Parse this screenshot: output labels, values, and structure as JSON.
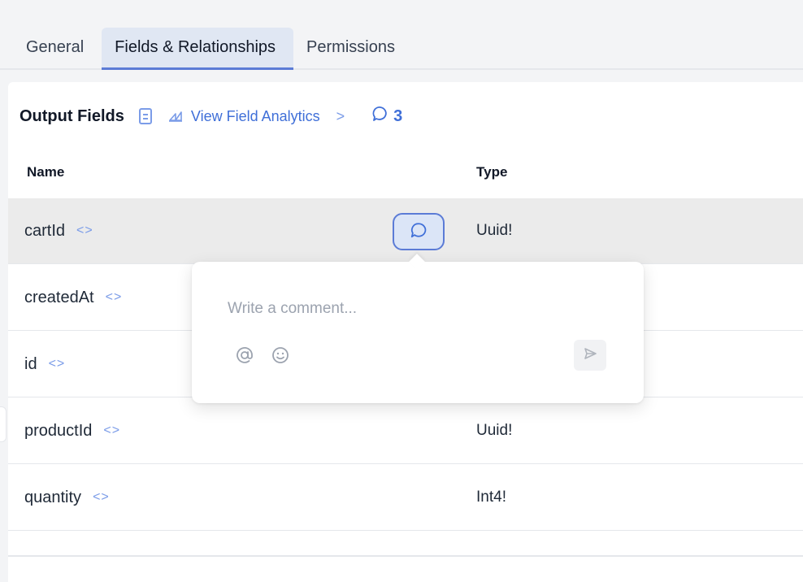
{
  "tabs": [
    {
      "label": "General",
      "active": false
    },
    {
      "label": "Fields & Relationships",
      "active": true
    },
    {
      "label": "Permissions",
      "active": false
    }
  ],
  "output": {
    "title": "Output Fields",
    "docs_icon": "document-icon",
    "analytics_label": "View Field Analytics",
    "analytics_icon": "chart-icon",
    "chevron": ">",
    "comment_count": "3",
    "comment_icon": "comment-bubble-icon"
  },
  "table": {
    "columns": [
      "Name",
      "Type"
    ],
    "rows": [
      {
        "name": "cartId",
        "type": "Uuid!",
        "highlighted": true
      },
      {
        "name": "createdAt",
        "type": ""
      },
      {
        "name": "id",
        "type": ""
      },
      {
        "name": "productId",
        "type": "Uuid!"
      },
      {
        "name": "quantity",
        "type": "Int4!"
      }
    ],
    "code_icon": "<>"
  },
  "comment_popup": {
    "placeholder": "Write a comment...",
    "mention_icon": "at-sign-icon",
    "emoji_icon": "smiley-icon",
    "send_icon": "send-icon"
  },
  "colors": {
    "accent": "#3f6fd8",
    "accent_light": "#7b9ce8",
    "active_tab_bg": "#e0e7f3",
    "highlight_row": "#ebebeb",
    "page_bg": "#f3f4f6"
  }
}
